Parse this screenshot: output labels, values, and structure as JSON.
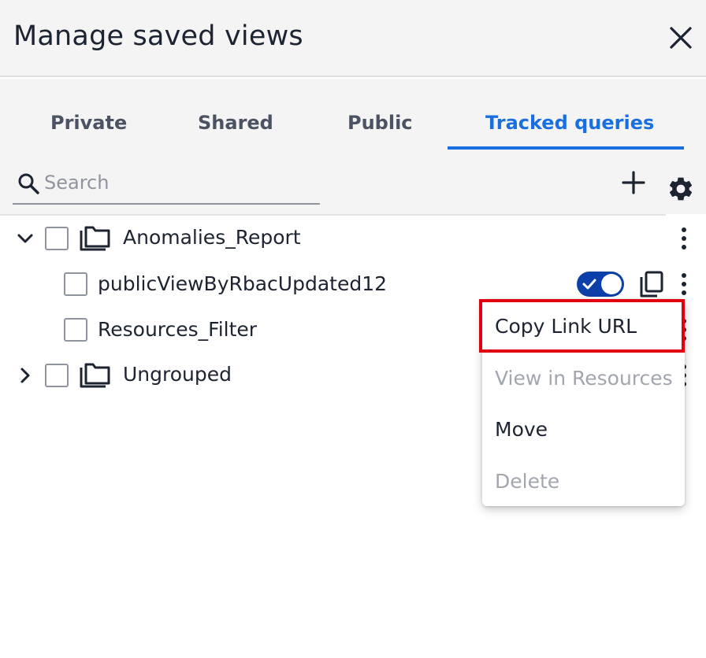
{
  "header": {
    "title": "Manage saved views"
  },
  "tabs": [
    {
      "label": "Private"
    },
    {
      "label": "Shared"
    },
    {
      "label": "Public"
    },
    {
      "label": "Tracked queries",
      "active": true
    }
  ],
  "search": {
    "placeholder": "Search",
    "value": ""
  },
  "tree": [
    {
      "type": "group",
      "label": "Anomalies_Report",
      "expanded": true,
      "checked": false
    },
    {
      "type": "view",
      "label": "publicViewByRbacUpdated12",
      "checked": false,
      "toggle_on": true
    },
    {
      "type": "view",
      "label": "Resources_Filter",
      "checked": false
    },
    {
      "type": "group",
      "label": "Ungrouped",
      "expanded": false,
      "checked": false
    }
  ],
  "context_menu": {
    "items": [
      {
        "label": "Copy Link URL",
        "enabled": true,
        "highlighted": true
      },
      {
        "label": "View in Resources",
        "enabled": false
      },
      {
        "label": "Move",
        "enabled": true
      },
      {
        "label": "Delete",
        "enabled": false
      }
    ]
  },
  "colors": {
    "accent": "#1a6fe0",
    "toggle": "#0c3fa8",
    "highlight": "#e0000f",
    "header_bg": "#f4f4f5"
  },
  "icons": [
    "close-icon",
    "search-icon",
    "plus-icon",
    "gear-icon",
    "chevron-down-icon",
    "chevron-right-icon",
    "folder-icon",
    "kebab-icon",
    "copy-icon",
    "check-icon"
  ]
}
